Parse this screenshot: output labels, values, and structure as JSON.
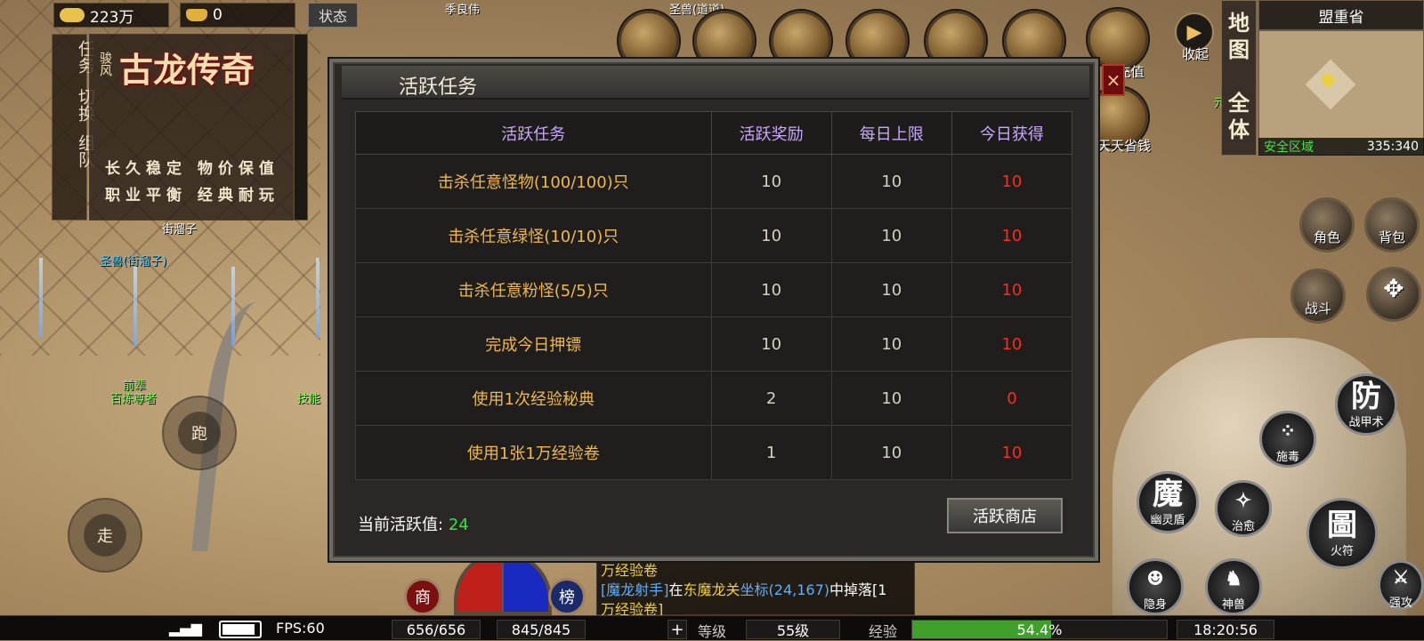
{
  "resources": {
    "gold": "223万",
    "ingot": "0",
    "status_button": "状态"
  },
  "left_panel": {
    "tabs": [
      "任务",
      "切换",
      "组队"
    ],
    "logo_small": "骏风",
    "logo": "古龙传奇",
    "slogan_line1": "长久稳定 物价保值",
    "slogan_line2": "职业平衡 经典耐玩"
  },
  "npc_labels": {
    "npc1": "街溜子",
    "npc1_pet": "圣兽(街溜子)",
    "npc2_title": "前辈",
    "npc2": "百炼尊者",
    "npc3": "技能",
    "top_name1": "季良伟",
    "top_name2": "圣兽(道道)"
  },
  "top_icons": {
    "recharge": "线充值",
    "collapse": "收起",
    "daily_save": "天天省钱",
    "yuanbao": "元宝"
  },
  "minimap": {
    "side_labels": [
      "地图",
      "全体"
    ],
    "region": "盟重省",
    "zone": "安全区域",
    "coords": "335:340"
  },
  "right_buttons": {
    "role": "角色",
    "bag": "背包",
    "fight": "战斗",
    "defense_char": "防",
    "defense": "战甲术",
    "poison": "施毒",
    "magic_char": "魔",
    "magic_shield": "幽灵盾",
    "heal": "治愈",
    "talisman_char": "圖",
    "talisman": "火符",
    "stealth": "隐身",
    "beast": "神兽",
    "attack": "强攻"
  },
  "joystick": {
    "run": "跑",
    "walk": "走"
  },
  "dialog": {
    "title": "活跃任务",
    "close": "×",
    "headers": [
      "活跃任务",
      "活跃奖励",
      "每日上限",
      "今日获得"
    ],
    "rows": [
      {
        "task": "击杀任意怪物(100/100)只",
        "reward": "10",
        "limit": "10",
        "got": "10"
      },
      {
        "task": "击杀任意绿怪(10/10)只",
        "reward": "10",
        "limit": "10",
        "got": "10"
      },
      {
        "task": "击杀任意粉怪(5/5)只",
        "reward": "10",
        "limit": "10",
        "got": "10"
      },
      {
        "task": "完成今日押镖",
        "reward": "10",
        "limit": "10",
        "got": "10"
      },
      {
        "task": "使用1次经验秘典",
        "reward": "2",
        "limit": "10",
        "got": "0"
      },
      {
        "task": "使用1张1万经验卷",
        "reward": "1",
        "limit": "10",
        "got": "10"
      }
    ],
    "current_label": "当前活跃值:",
    "current_value": "24",
    "shop_button": "活跃商店"
  },
  "chat": {
    "line0": "万经验卷",
    "sender": "[魔龙射手]",
    "text1": "在",
    "place": "东魔龙关",
    "text2": "坐标(24,167)",
    "text3": "中掉落[1",
    "line2": "万经验卷]"
  },
  "orb_buttons": {
    "shop": "商",
    "rank": "榜"
  },
  "bottom": {
    "fps": "FPS:60",
    "hp": "656/656",
    "mp": "845/845",
    "level_label": "等级",
    "level": "55级",
    "exp_label": "经验",
    "exp": "54.4%",
    "exp_fraction": 0.544,
    "time": "18:20:56"
  }
}
